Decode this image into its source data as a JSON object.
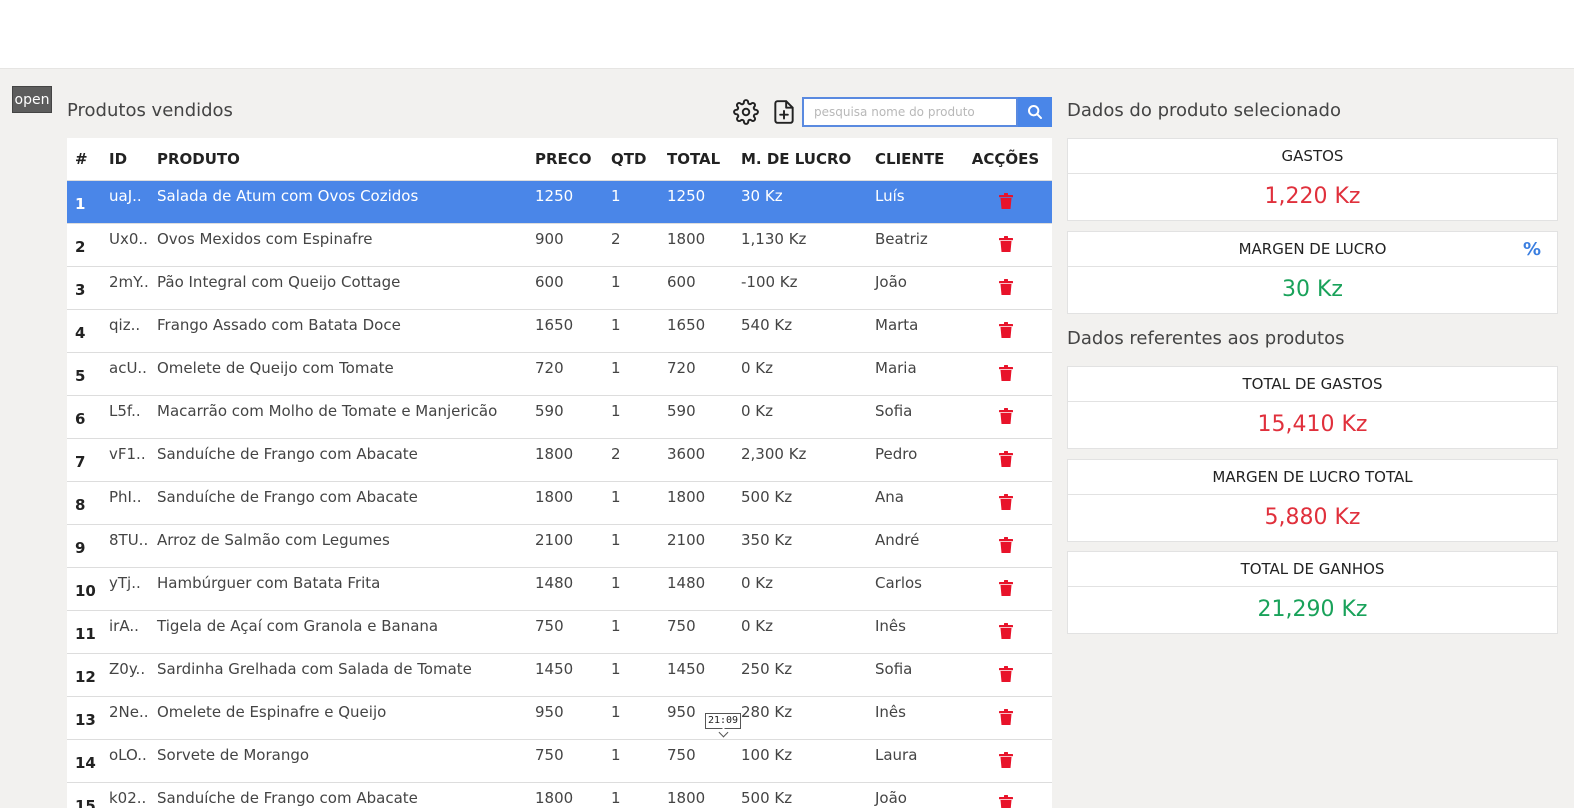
{
  "sidebar_toggle": "open",
  "sales": {
    "title": "Produtos vendidos",
    "search_placeholder": "pesquisa nome do produto",
    "columns": [
      "#",
      "ID",
      "PRODUTO",
      "PRECO",
      "QTD",
      "TOTAL",
      "M. DE LUCRO",
      "CLIENTE",
      "ACÇÕES"
    ],
    "rows": [
      [
        "1",
        "uaJ..",
        "Salada de Atum com Ovos Cozidos",
        "1250",
        "1",
        "1250",
        "30 Kz",
        "Luís"
      ],
      [
        "2",
        "Ux0..",
        "Ovos Mexidos com Espinafre",
        "900",
        "2",
        "1800",
        "1,130 Kz",
        "Beatriz"
      ],
      [
        "3",
        "2mY..",
        "Pão Integral com Queijo Cottage",
        "600",
        "1",
        "600",
        "-100 Kz",
        "João"
      ],
      [
        "4",
        "qiz..",
        "Frango Assado com Batata Doce",
        "1650",
        "1",
        "1650",
        "540 Kz",
        "Marta"
      ],
      [
        "5",
        "acU..",
        "Omelete de Queijo com Tomate",
        "720",
        "1",
        "720",
        "0 Kz",
        "Maria"
      ],
      [
        "6",
        "L5f..",
        "Macarrão com Molho de Tomate e Manjericão",
        "590",
        "1",
        "590",
        "0 Kz",
        "Sofia"
      ],
      [
        "7",
        "vF1..",
        "Sanduíche de Frango com Abacate",
        "1800",
        "2",
        "3600",
        "2,300 Kz",
        "Pedro"
      ],
      [
        "8",
        "PhI..",
        "Sanduíche de Frango com Abacate",
        "1800",
        "1",
        "1800",
        "500 Kz",
        "Ana"
      ],
      [
        "9",
        "8TU..",
        "Arroz de Salmão com Legumes",
        "2100",
        "1",
        "2100",
        "350 Kz",
        "André"
      ],
      [
        "10",
        "yTj..",
        "Hambúrguer com Batata Frita",
        "1480",
        "1",
        "1480",
        "0 Kz",
        "Carlos"
      ],
      [
        "11",
        "irA..",
        "Tigela de Açaí com Granola e Banana",
        "750",
        "1",
        "750",
        "0 Kz",
        "Inês"
      ],
      [
        "12",
        "Z0y..",
        "Sardinha Grelhada com Salada de Tomate",
        "1450",
        "1",
        "1450",
        "250 Kz",
        "Sofia"
      ],
      [
        "13",
        "2Ne..",
        "Omelete de Espinafre e Queijo",
        "950",
        "1",
        "950",
        "280 Kz",
        "Inês"
      ],
      [
        "14",
        "oLO..",
        "Sorvete de Morango",
        "750",
        "1",
        "750",
        "100 Kz",
        "Laura"
      ],
      [
        "15",
        "k02..",
        "Sanduíche de Frango com Abacate",
        "1800",
        "1",
        "1800",
        "500 Kz",
        "João"
      ]
    ],
    "selected_row": 0,
    "tooltip": "21:09"
  },
  "selected_product": {
    "title": "Dados do produto selecionado",
    "gastos_label": "GASTOS",
    "gastos_value": "1,220 Kz",
    "margem_label": "MARGEN DE LUCRO",
    "margem_toggle": "%",
    "margem_value": "30 Kz"
  },
  "totals": {
    "title": "Dados referentes aos produtos",
    "total_gastos_label": "TOTAL DE GASTOS",
    "total_gastos_value": "15,410 Kz",
    "margem_total_label": "MARGEN DE LUCRO TOTAL",
    "margem_total_value": "5,880 Kz",
    "total_ganhos_label": "TOTAL DE GANHOS",
    "total_ganhos_value": "21,290 Kz"
  },
  "colors": {
    "accent": "#4a86e8",
    "negative": "#e0303c",
    "positive": "#19a25a"
  },
  "icons": {
    "settings": "gear-icon",
    "add_file": "file-plus-icon",
    "search": "search-icon",
    "delete": "trash-icon"
  }
}
